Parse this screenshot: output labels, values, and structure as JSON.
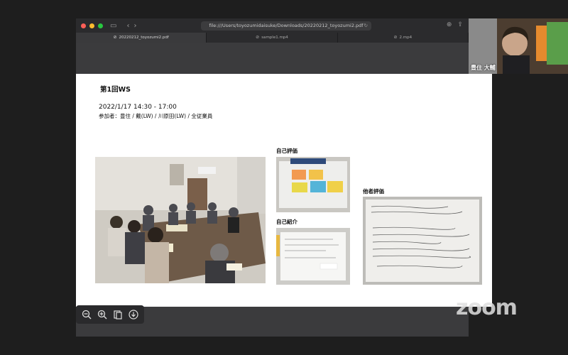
{
  "browser": {
    "url": "file:///Users/toyozumidaisuke/Downloads/20220212_toyozumi2.pdf",
    "tabs": [
      {
        "label": "20220212_toyozumi2.pdf",
        "active": true
      },
      {
        "label": "sample1.mp4",
        "active": false
      },
      {
        "label": "2.mp4",
        "active": false
      }
    ]
  },
  "slide": {
    "title": "第1回WS",
    "datetime": "2022/1/17 14:30 - 17:00",
    "participants": "参加者：豊住 / 戴(LW) / 川原田(LW) / 全従業員",
    "label_self_eval": "自己評価",
    "label_self_intro": "自己紹介",
    "label_peer_eval": "他者評価"
  },
  "webcam": {
    "name": "豊住 大輔"
  },
  "zoom_logo": "zoom",
  "colors": {
    "background": "#1e1e1e",
    "toolbar": "#2b2b2d",
    "page": "#ffffff",
    "traffic_red": "#ff5f57",
    "traffic_yellow": "#febc2e",
    "traffic_green": "#28c840"
  }
}
